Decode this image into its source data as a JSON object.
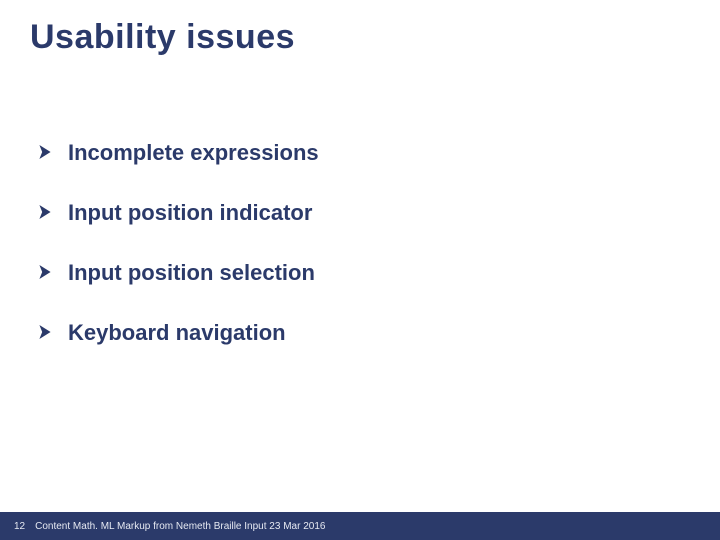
{
  "title": "Usability issues",
  "bullets": [
    "Incomplete expressions",
    "Input position indicator",
    "Input position selection",
    "Keyboard navigation"
  ],
  "footer": {
    "page": "12",
    "text": "Content Math. ML Markup from Nemeth Braille Input  23 Mar 2016"
  }
}
